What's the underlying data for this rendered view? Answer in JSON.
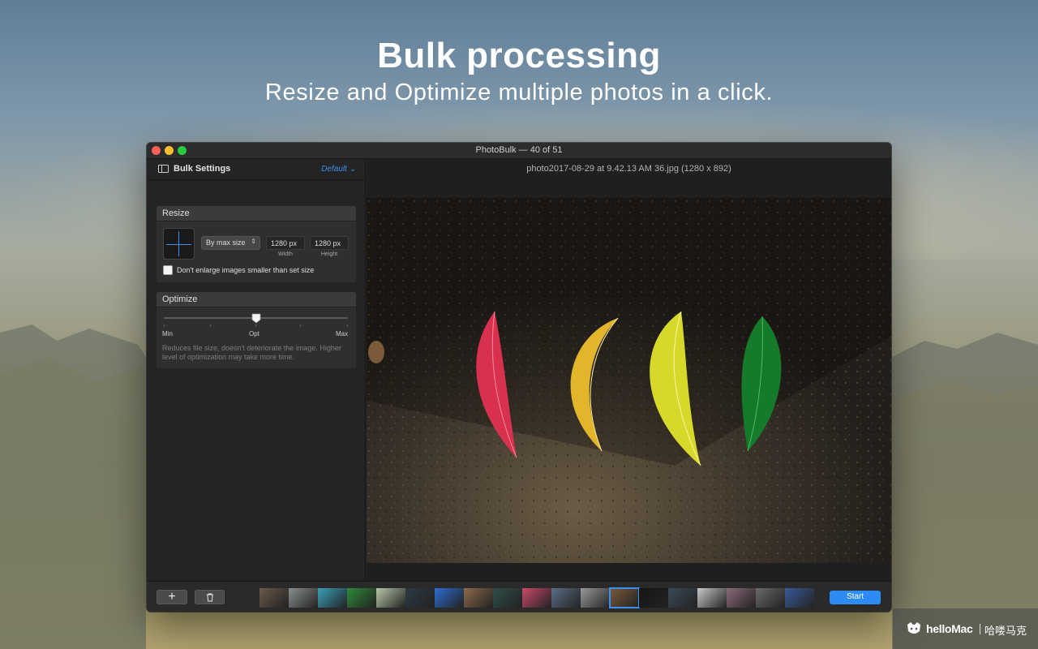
{
  "hero": {
    "title": "Bulk processing",
    "subtitle": "Resize and Optimize multiple photos in a click."
  },
  "window": {
    "title": "PhotoBulk — 40 of 51",
    "traffic_lights": [
      "close",
      "minimize",
      "zoom"
    ]
  },
  "sidebar": {
    "title": "Bulk Settings",
    "preset": "Default",
    "preset_icon": "chevron-down-icon"
  },
  "resize": {
    "header": "Resize",
    "mode": "By max size",
    "width": "1280 px",
    "height": "1280 px",
    "width_label": "Width",
    "height_label": "Height",
    "dont_enlarge_label": "Don't enlarge images smaller than set size",
    "dont_enlarge_checked": false
  },
  "optimize": {
    "header": "Optimize",
    "min_label": "Min",
    "opt_label": "Opt",
    "max_label": "Max",
    "level": 0.5,
    "description": "Reduces file size, doesn't deteriorate the image. Higher level of optimization may take more time."
  },
  "preview": {
    "filename": "photo2017-08-29 at 9.42.13 AM 36.jpg (1280 x 892)"
  },
  "toolbar": {
    "add_label": "+",
    "delete_icon": "trash-icon",
    "start_label": "Start"
  },
  "thumbnail_colors": [
    "#6b5a4a",
    "#8a8f90",
    "#3aa0b8",
    "#2f8a3a",
    "#b9c7a8",
    "#2b3a44",
    "#2c6ccf",
    "#8d6a4b",
    "#2f4e4a",
    "#c94a6b",
    "#5a6f86",
    "#9a9a9a",
    "#7a5a3a",
    "#151515",
    "#3a4a5a",
    "#c8c8c8",
    "#8a6a7a",
    "#6a6a6a",
    "#3a5a9a"
  ],
  "selected_thumbnail": 12,
  "watermark": {
    "brand": "helloMac",
    "cn": "哈喽马克"
  }
}
